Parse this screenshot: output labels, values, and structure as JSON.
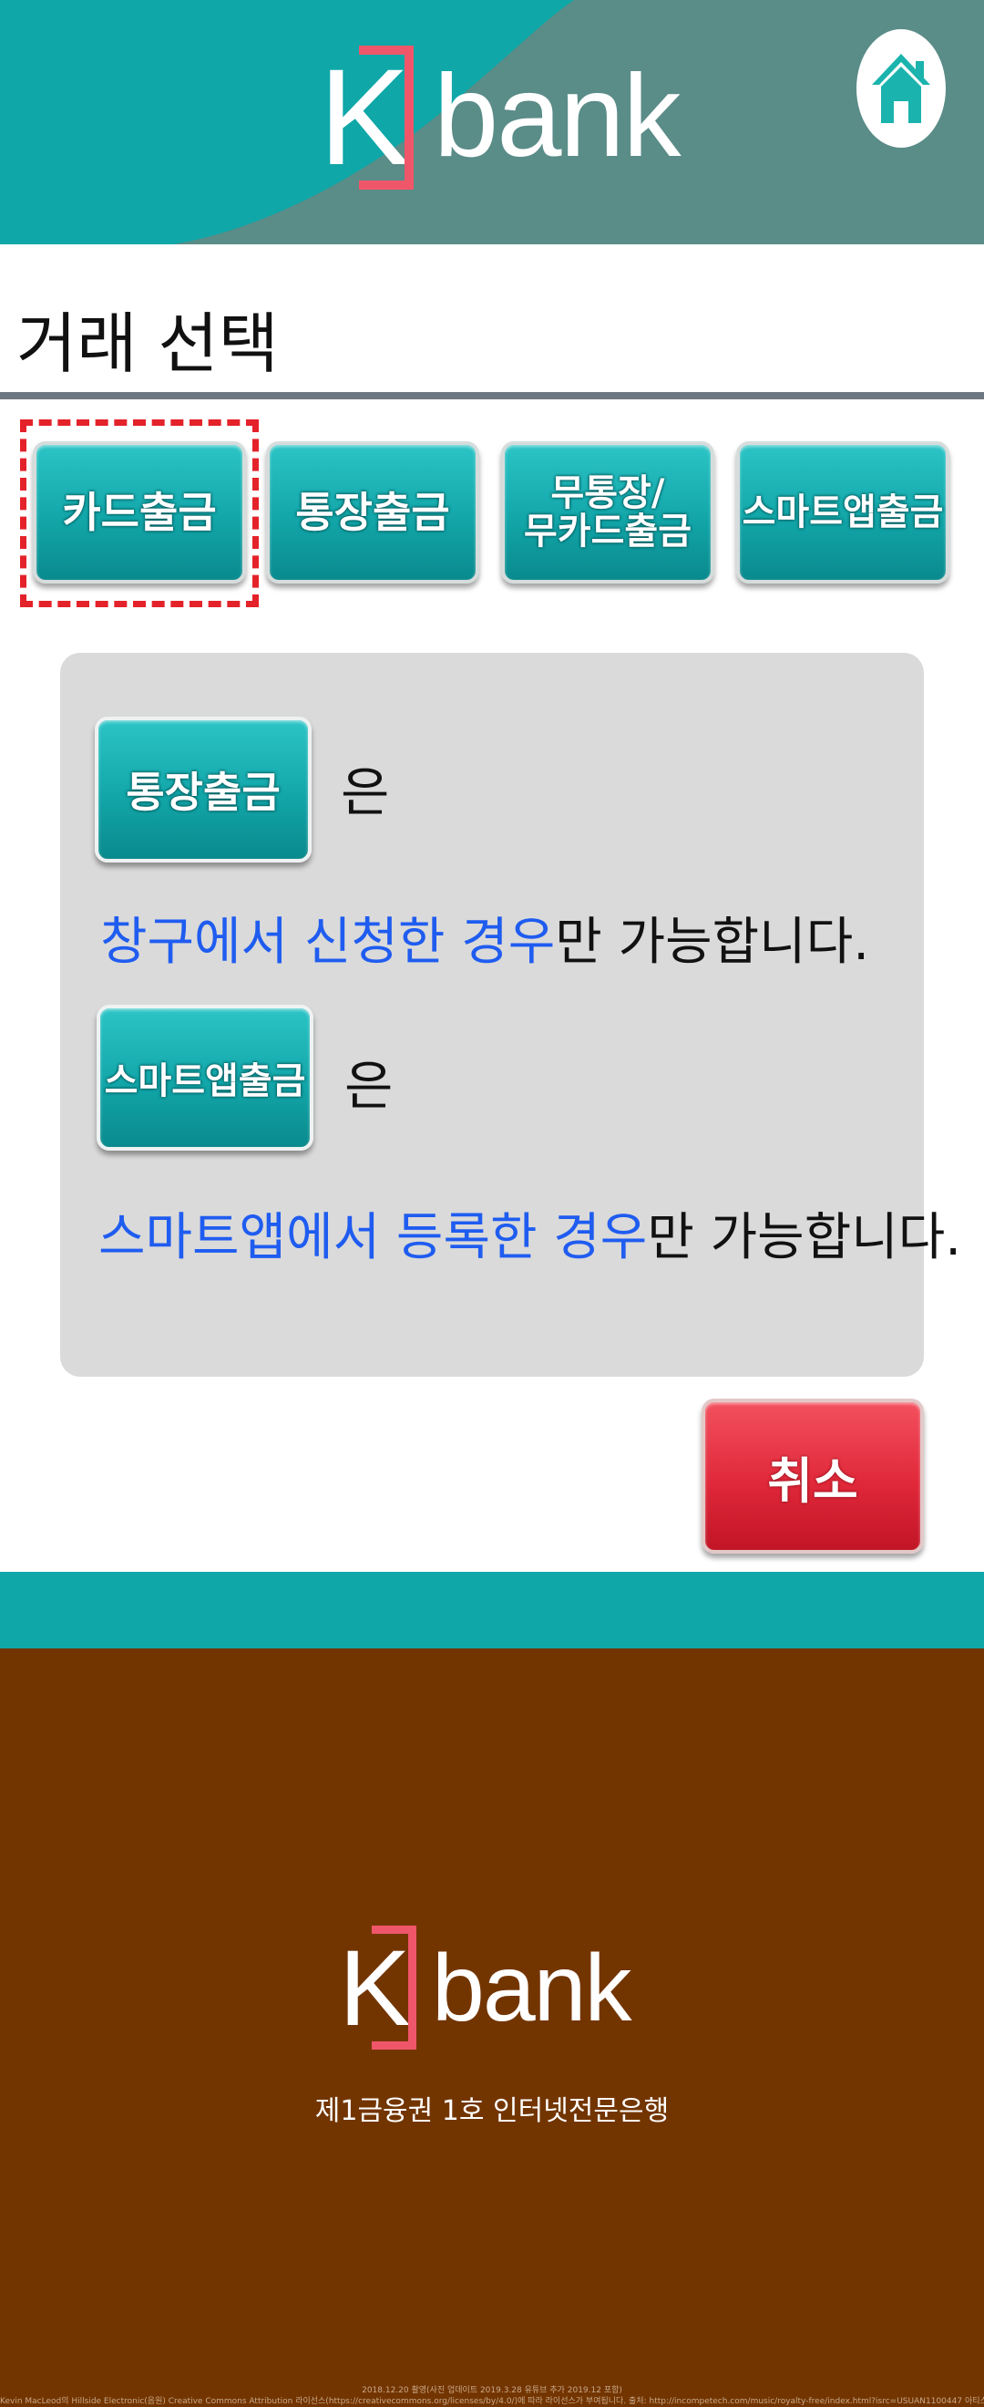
{
  "brand": {
    "logo_k": "K",
    "logo_word": "bank",
    "tagline": "제1금융권 1호 인터넷전문은행"
  },
  "colors": {
    "teal": "#0fa7a8",
    "accent_red": "#f0566a",
    "highlight_blue": "#1f5cf0",
    "footer_brown": "#733500"
  },
  "header": {
    "home_icon": "home-icon"
  },
  "page": {
    "title": "거래 선택"
  },
  "transaction_buttons": [
    {
      "label": "카드출금",
      "selected": true
    },
    {
      "label": "통장출금"
    },
    {
      "label": "무통장/\n무카드출금"
    },
    {
      "label": "스마트앱출금"
    }
  ],
  "info": {
    "passbook_button": "통장출금",
    "passbook_particle": "은",
    "passbook_note_highlight": "창구에서 신청한 경우",
    "passbook_note_rest": "만 가능합니다.",
    "smartapp_button": "스마트앱출금",
    "smartapp_particle": "은",
    "smartapp_note_highlight": "스마트앱에서 등록한 경우",
    "smartapp_note_rest": "만 가능합니다."
  },
  "cancel_label": "취소",
  "footer_credit": {
    "line1": "2018.12.20 촬영(사진 업데이트 2019.3.28 유튜브 추가 2019.12 포함)",
    "line2": "Kevin MacLeod의 Hillside Electronic(음원) Creative Commons Attribution 라이선스(https://creativecommons.org/licenses/by/4.0/)에 따라 라이선스가 부여됩니다. 출처: http://incompetech.com/music/royalty-free/index.html?isrc=USUAN1100447 아티스트: http://incompetech.com/"
  }
}
